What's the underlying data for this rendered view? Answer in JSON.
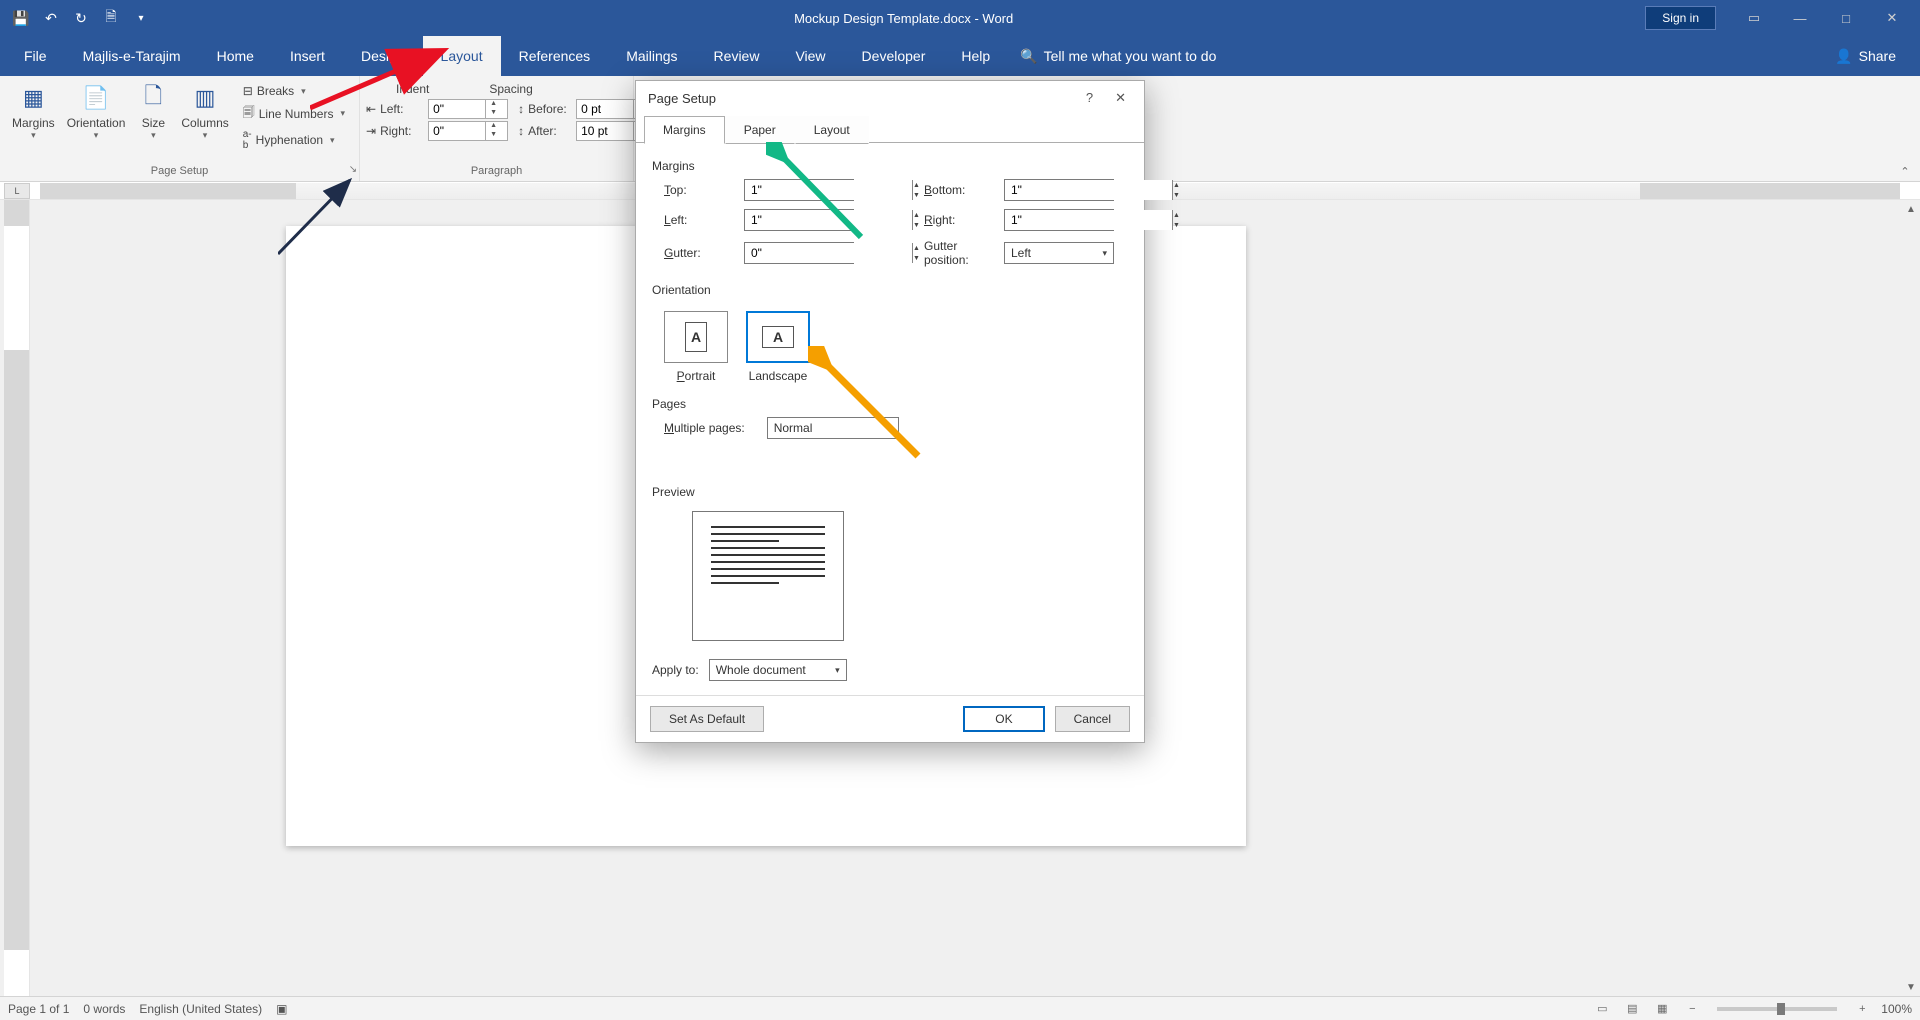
{
  "title": "Mockup Design Template.docx - Word",
  "signin": "Sign in",
  "tabs": [
    "File",
    "Majlis-e-Tarajim",
    "Home",
    "Insert",
    "Design",
    "Layout",
    "References",
    "Mailings",
    "Review",
    "View",
    "Developer",
    "Help"
  ],
  "active_tab": "Layout",
  "tellme": "Tell me what you want to do",
  "share": "Share",
  "ribbon": {
    "page_setup": {
      "label": "Page Setup",
      "margins": "Margins",
      "orientation": "Orientation",
      "size": "Size",
      "columns": "Columns",
      "breaks": "Breaks",
      "line_numbers": "Line Numbers",
      "hyphenation": "Hyphenation"
    },
    "paragraph": {
      "label": "Paragraph",
      "indent_header": "Indent",
      "spacing_header": "Spacing",
      "left": "Left:",
      "right": "Right:",
      "before": "Before:",
      "after": "After:",
      "left_val": "0\"",
      "right_val": "0\"",
      "before_val": "0 pt",
      "after_val": "10 pt"
    }
  },
  "dialog": {
    "title": "Page Setup",
    "tabs": {
      "margins": "Margins",
      "paper": "Paper",
      "layout": "Layout"
    },
    "section_margins": "Margins",
    "top": "Top:",
    "top_val": "1\"",
    "bottom": "Bottom:",
    "bottom_val": "1\"",
    "left": "Left:",
    "left_val": "1\"",
    "right": "Right:",
    "right_val": "1\"",
    "gutter": "Gutter:",
    "gutter_val": "0\"",
    "gutter_pos": "Gutter position:",
    "gutter_pos_val": "Left",
    "section_orientation": "Orientation",
    "portrait": "Portrait",
    "landscape": "Landscape",
    "section_pages": "Pages",
    "multiple_pages": "Multiple pages:",
    "multiple_pages_val": "Normal",
    "section_preview": "Preview",
    "apply_to": "Apply to:",
    "apply_to_val": "Whole document",
    "set_default": "Set As Default",
    "ok": "OK",
    "cancel": "Cancel"
  },
  "status": {
    "page": "Page 1 of 1",
    "words": "0 words",
    "lang": "English (United States)",
    "zoom": "100%"
  }
}
